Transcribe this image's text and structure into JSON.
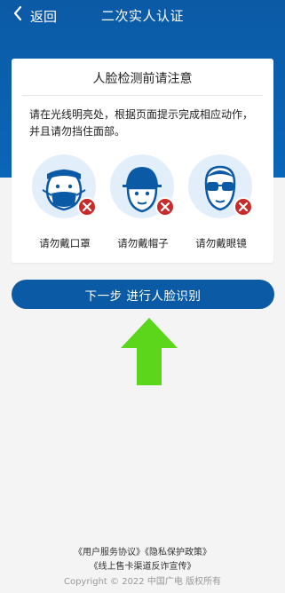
{
  "header": {
    "back_label": "返回",
    "title": "二次实人认证",
    "bg_color": "#0b5aa6"
  },
  "card": {
    "title": "人脸检测前请注意",
    "description": "请在光线明亮处，根据页面提示完成相应动作，并且请勿挡住面部。",
    "tips": [
      {
        "icon": "face-mask-icon",
        "label": "请勿戴口罩"
      },
      {
        "icon": "cap-icon",
        "label": "请勿戴帽子"
      },
      {
        "icon": "sunglasses-icon",
        "label": "请勿戴眼镜"
      }
    ]
  },
  "next_button": {
    "label": "下一步 进行人脸识别",
    "color": "#0b5aa6"
  },
  "annotation": {
    "icon": "green-up-arrow-icon",
    "color": "#5cd61a"
  },
  "footer": {
    "links": [
      "《用户服务协议》",
      "《隐私保护政策》",
      "《线上售卡渠道反诈宣传》"
    ],
    "copyright": "Copyright © 2022 中国广电 版权所有"
  }
}
